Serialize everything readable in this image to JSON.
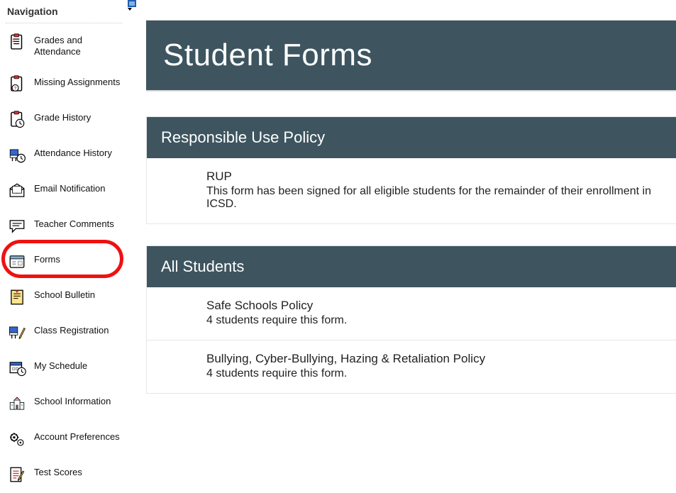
{
  "sidebar": {
    "title": "Navigation",
    "items": [
      {
        "label": "Grades and Attendance"
      },
      {
        "label": "Missing Assignments"
      },
      {
        "label": "Grade History"
      },
      {
        "label": "Attendance History"
      },
      {
        "label": "Email Notification"
      },
      {
        "label": "Teacher Comments"
      },
      {
        "label": "Forms"
      },
      {
        "label": "School Bulletin"
      },
      {
        "label": "Class Registration"
      },
      {
        "label": "My Schedule"
      },
      {
        "label": "School Information"
      },
      {
        "label": "Account Preferences"
      },
      {
        "label": "Test Scores"
      }
    ]
  },
  "main": {
    "page_title": "Student Forms",
    "sections": [
      {
        "title": "Responsible Use Policy",
        "forms": [
          {
            "title": "RUP",
            "desc": "This form has been signed for all eligible students for the remainder of their enrollment in ICSD."
          }
        ]
      },
      {
        "title": "All Students",
        "forms": [
          {
            "title": "Safe Schools Policy",
            "desc": "4 students require this form."
          },
          {
            "title": "Bullying, Cyber-Bullying, Hazing & Retaliation Policy",
            "desc": "4 students require this form."
          }
        ]
      }
    ]
  }
}
